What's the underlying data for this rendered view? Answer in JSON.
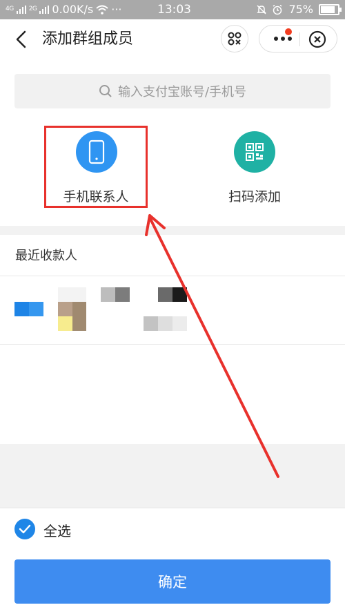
{
  "status_bar": {
    "signal_1": "4G",
    "signal_2": "2G",
    "speed": "0.00K/s",
    "more": "···",
    "time": "13:03",
    "battery": "75%"
  },
  "header": {
    "title": "添加群组成员"
  },
  "search": {
    "placeholder": "输入支付宝账号/手机号"
  },
  "options": [
    {
      "label": "手机联系人",
      "icon": "phone-icon",
      "color": "#2f95f2"
    },
    {
      "label": "扫码添加",
      "icon": "qr-code-icon",
      "color": "#1fb1a4"
    }
  ],
  "recent": {
    "label": "最近收款人"
  },
  "footer": {
    "select_all": "全选",
    "confirm": "确定"
  },
  "colors": {
    "accent_blue": "#3e8cf0",
    "highlight_red": "#e8312c"
  }
}
